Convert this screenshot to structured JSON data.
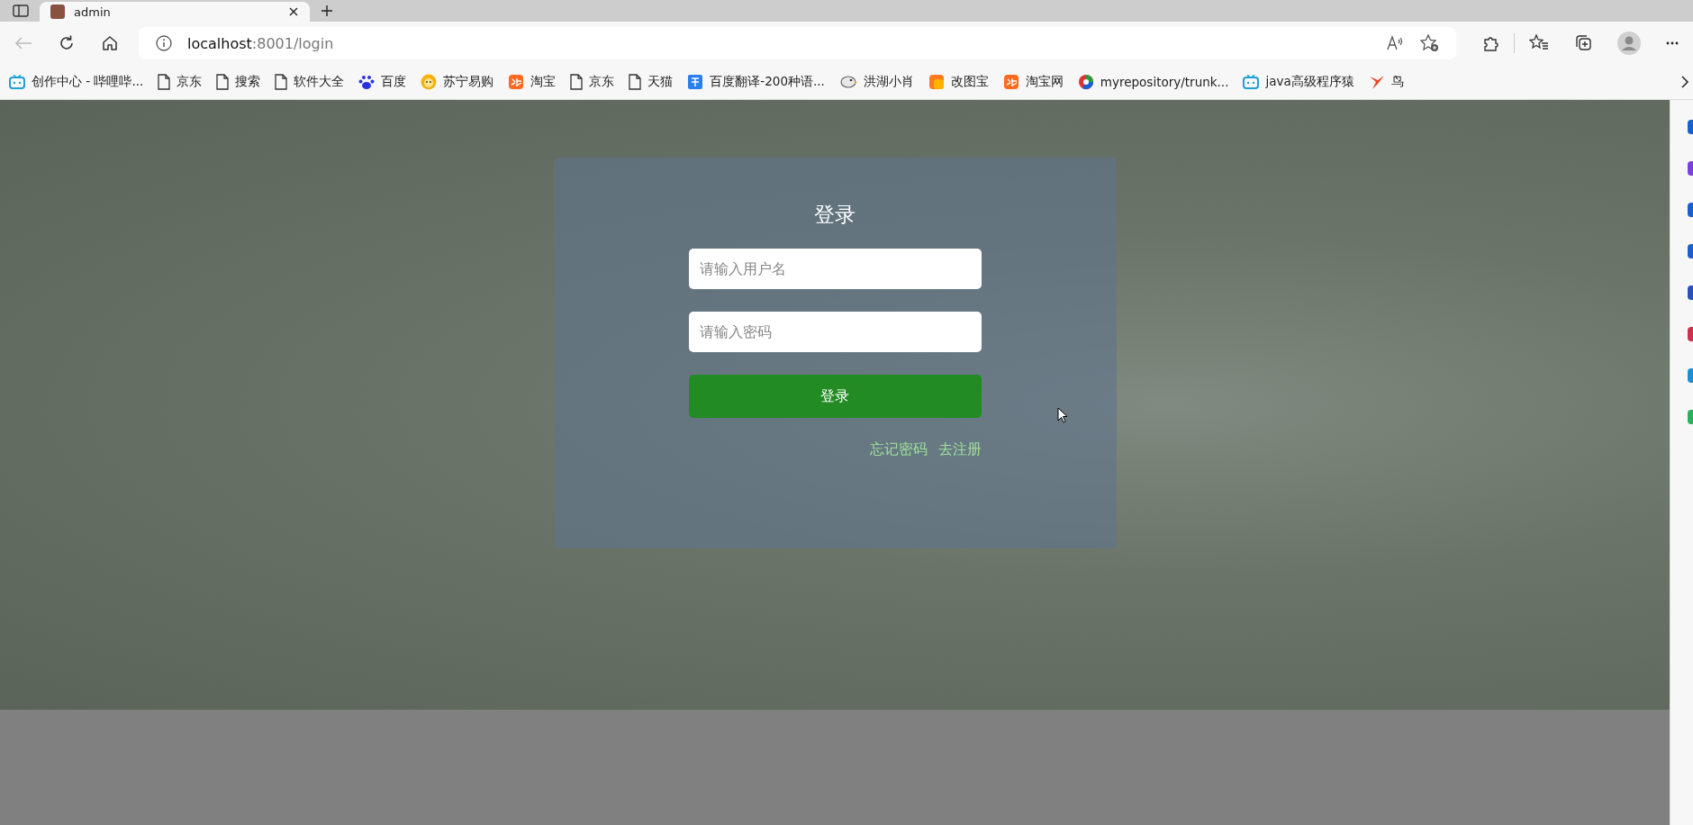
{
  "tab": {
    "title": "admin"
  },
  "address_bar": {
    "host": "localhost",
    "path": ":8001/login"
  },
  "bookmarks": [
    {
      "label": "创作中心 - 哔哩哔...",
      "kind": "tv"
    },
    {
      "label": "京东",
      "kind": "page"
    },
    {
      "label": "搜索",
      "kind": "page"
    },
    {
      "label": "软件大全",
      "kind": "page"
    },
    {
      "label": "百度",
      "kind": "paw"
    },
    {
      "label": "苏宁易购",
      "kind": "lion"
    },
    {
      "label": "淘宝",
      "kind": "orange"
    },
    {
      "label": "京东",
      "kind": "page"
    },
    {
      "label": "天猫",
      "kind": "page"
    },
    {
      "label": "百度翻译-200种语...",
      "kind": "translate"
    },
    {
      "label": "洪湖小肖",
      "kind": "bird"
    },
    {
      "label": "改图宝",
      "kind": "square"
    },
    {
      "label": "淘宝网",
      "kind": "orange"
    },
    {
      "label": "myrepository/trunk...",
      "kind": "globe"
    },
    {
      "label": "java高级程序猿",
      "kind": "tv"
    },
    {
      "label": "鸟",
      "kind": "redbird"
    }
  ],
  "login": {
    "title": "登录",
    "username_placeholder": "请输入用户名",
    "password_placeholder": "请输入密码",
    "submit": "登录",
    "links": [
      "忘记密码",
      "去注册"
    ]
  }
}
